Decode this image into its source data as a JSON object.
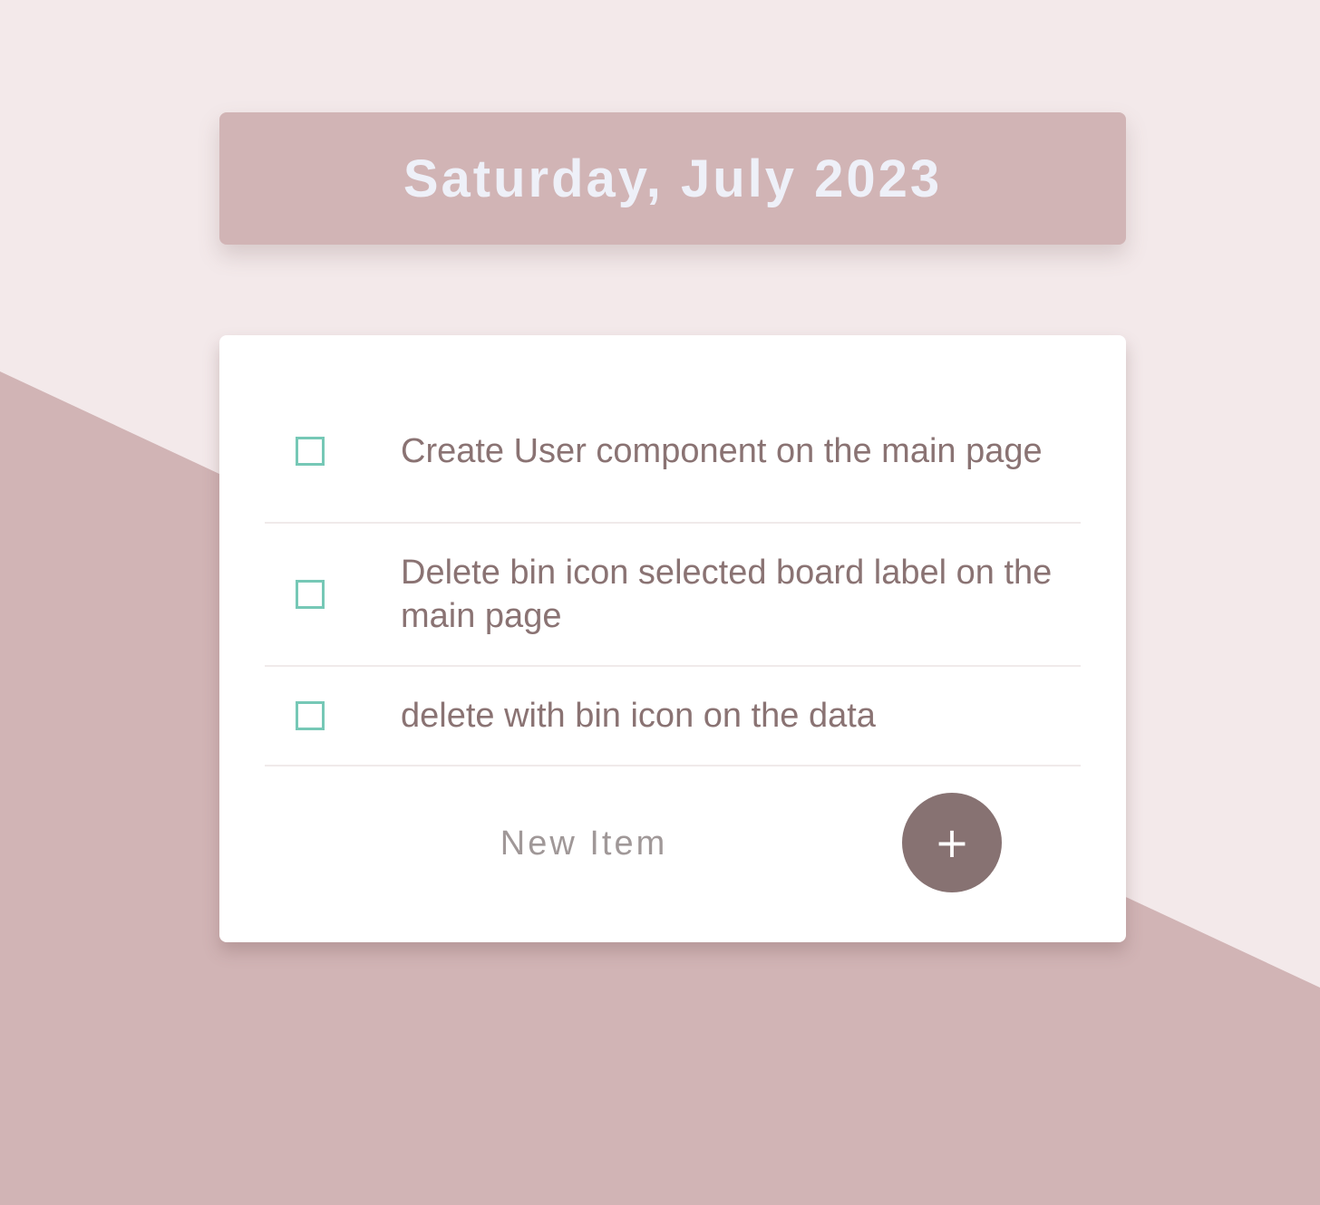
{
  "header": {
    "title": "Saturday, July 2023"
  },
  "todo": {
    "items": [
      {
        "text": "Create User component on the main page",
        "checked": false
      },
      {
        "text": "Delete bin icon selected board label on the main page",
        "checked": false
      },
      {
        "text": "delete with bin icon on the data",
        "checked": false
      }
    ],
    "new_item_placeholder": "New Item",
    "add_button_label": "+"
  },
  "colors": {
    "background_light": "#f3e9ea",
    "accent_pink": "#d1b4b5",
    "text": "#8a7373",
    "checkbox_border": "#76c8b6",
    "button": "#877272"
  }
}
